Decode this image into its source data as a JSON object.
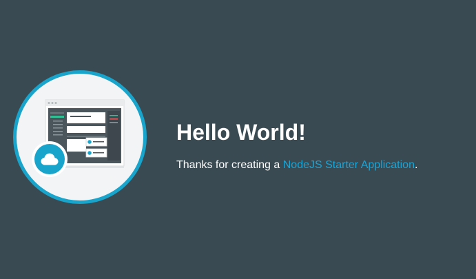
{
  "hero": {
    "illustration_icon": "app-window-illustration",
    "cloud_icon": "cloud-icon"
  },
  "main": {
    "title": "Hello World!",
    "intro_prefix": "Thanks for creating a ",
    "intro_link": "NodeJS Starter Application",
    "intro_suffix": "."
  },
  "colors": {
    "background": "#3a4a52",
    "accent": "#19a4cc",
    "link": "#1aa5d6",
    "text": "#ffffff"
  }
}
